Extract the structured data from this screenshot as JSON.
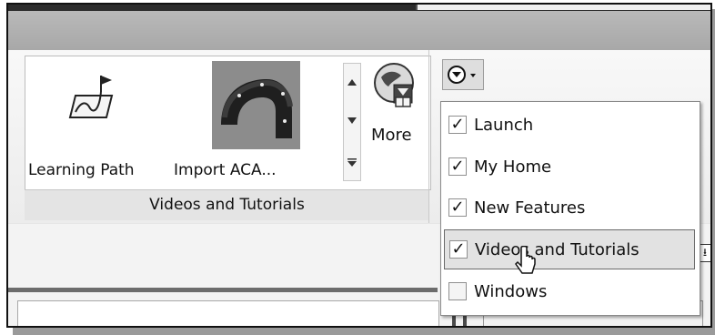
{
  "ribbon": {
    "panel_title": "Videos and Tutorials",
    "buttons": [
      {
        "label": "Learning Path",
        "icon": "learning-path-icon"
      },
      {
        "label": "Import ACA...",
        "icon": "import-aca-thumbnail"
      }
    ],
    "more_label": "More",
    "more_icon": "globe-download-icon"
  },
  "menu": {
    "trigger_icon": "chevron-circle-down-icon",
    "items": [
      {
        "label": "Launch",
        "checked": true
      },
      {
        "label": "My Home",
        "checked": true
      },
      {
        "label": "New Features",
        "checked": true
      },
      {
        "label": "Videos and Tutorials",
        "checked": true
      },
      {
        "label": "Windows",
        "checked": false
      }
    ],
    "hover_index": 3
  },
  "colors": {
    "menu_hover": "#e2e2e2",
    "titlebar": "#b0b0b0"
  }
}
